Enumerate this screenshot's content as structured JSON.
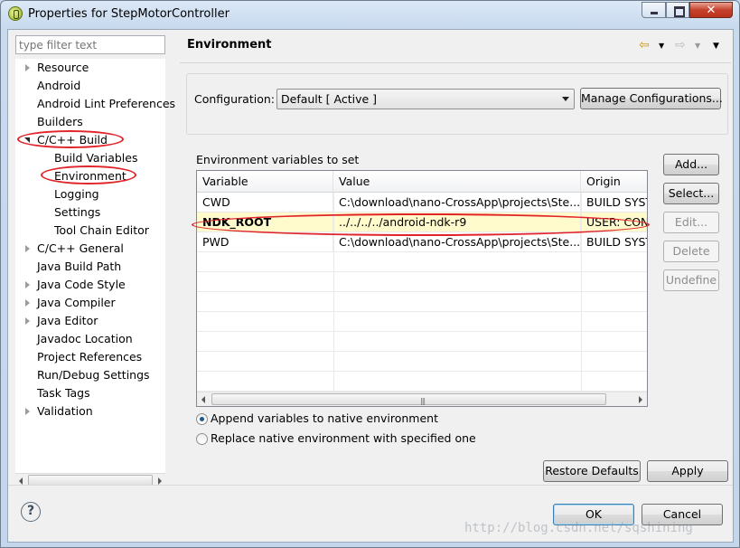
{
  "window": {
    "title": "Properties for StepMotorController"
  },
  "filter": {
    "placeholder": "type filter text"
  },
  "tree": {
    "items": [
      {
        "label": "Resource",
        "arrow": "closed"
      },
      {
        "label": "Android",
        "arrow": "none"
      },
      {
        "label": "Android Lint Preferences",
        "arrow": "none"
      },
      {
        "label": "Builders",
        "arrow": "none"
      },
      {
        "label": "C/C++ Build",
        "arrow": "open"
      },
      {
        "label": "Build Variables",
        "arrow": "none"
      },
      {
        "label": "Environment",
        "arrow": "none"
      },
      {
        "label": "Logging",
        "arrow": "none"
      },
      {
        "label": "Settings",
        "arrow": "none"
      },
      {
        "label": "Tool Chain Editor",
        "arrow": "none"
      },
      {
        "label": "C/C++ General",
        "arrow": "closed"
      },
      {
        "label": "Java Build Path",
        "arrow": "none"
      },
      {
        "label": "Java Code Style",
        "arrow": "closed"
      },
      {
        "label": "Java Compiler",
        "arrow": "closed"
      },
      {
        "label": "Java Editor",
        "arrow": "closed"
      },
      {
        "label": "Javadoc Location",
        "arrow": "none"
      },
      {
        "label": "Project References",
        "arrow": "none"
      },
      {
        "label": "Run/Debug Settings",
        "arrow": "none"
      },
      {
        "label": "Task Tags",
        "arrow": "none"
      },
      {
        "label": "Validation",
        "arrow": "closed"
      }
    ]
  },
  "page": {
    "title": "Environment",
    "configuration_label": "Configuration:",
    "configuration_value": "Default  [ Active ]",
    "manage_button": "Manage Configurations...",
    "env_label": "Environment variables to set"
  },
  "table": {
    "columns": [
      "Variable",
      "Value",
      "Origin"
    ],
    "rows": [
      {
        "variable": "CWD",
        "value": "C:\\download\\nano-CrossApp\\projects\\Ste...",
        "origin": "BUILD SYSTEM"
      },
      {
        "variable": "NDK_ROOT",
        "value": "../../../../android-ndk-r9",
        "origin": "USER: CONFIG"
      },
      {
        "variable": "PWD",
        "value": "C:\\download\\nano-CrossApp\\projects\\Ste...",
        "origin": "BUILD SYSTEM"
      }
    ],
    "selected_row": 1
  },
  "side_buttons": {
    "add": "Add...",
    "select": "Select...",
    "edit": "Edit...",
    "delete": "Delete",
    "undefine": "Undefine"
  },
  "options": {
    "append": "Append variables to native environment",
    "replace": "Replace native environment with specified one",
    "selected": "append"
  },
  "buttons": {
    "restore": "Restore Defaults",
    "apply": "Apply",
    "ok": "OK",
    "cancel": "Cancel"
  },
  "watermark": "http://blog.csdn.net/sqshining",
  "colors": {
    "selected_row": "#fffbcc",
    "annotation": "#e0242a"
  }
}
